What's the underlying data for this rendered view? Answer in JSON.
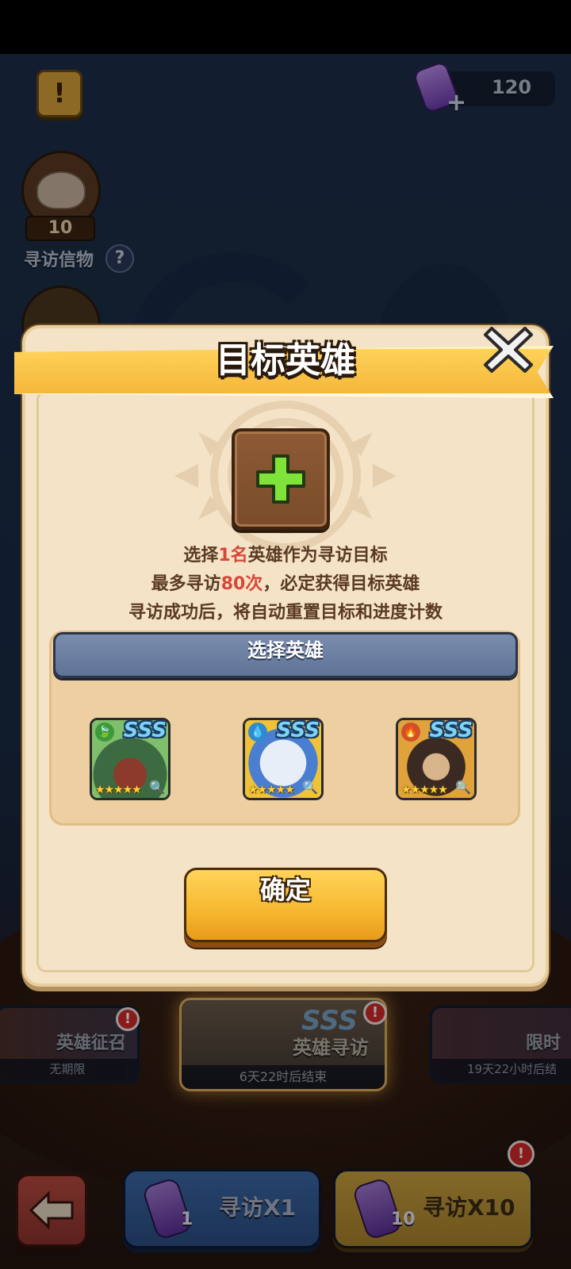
{
  "status_bar": {},
  "top": {
    "currency": {
      "value": "120",
      "icon": "scroll-icon",
      "add_icon": "plus-icon"
    },
    "info_icon": "exclamation-icon"
  },
  "sidebar": {
    "token": {
      "count": "10",
      "label": "寻访信物",
      "help": "?"
    }
  },
  "banners": [
    {
      "title": "英雄征召",
      "caption": "无期限",
      "alert": "!"
    },
    {
      "title": "英雄寻访",
      "caption": "6天22时后结束",
      "badge": "SSS",
      "alert": "!"
    },
    {
      "title": "限时",
      "caption": "19天22小时后结",
      "alert": ""
    }
  ],
  "bottom": {
    "visit1": {
      "label": "寻访X1",
      "count": "1"
    },
    "visit10": {
      "label": "寻访X10",
      "count": "10",
      "alert": "!"
    }
  },
  "dialog": {
    "title": "目标英雄",
    "desc_line1_pre": "选择",
    "desc_line1_hl": "1名",
    "desc_line1_post": "英雄作为寻访目标",
    "desc_line2_pre": "最多寻访",
    "desc_line2_hl": "80次",
    "desc_line2_post": "，必定获得目标英雄",
    "desc_line3": "寻访成功后，将自动重置目标和进度计数",
    "select_header": "选择英雄",
    "heroes": [
      {
        "rank": "SSS",
        "element": "leaf",
        "element_glyph": "🍃",
        "stars": "★★★★★",
        "zoom": "🔍"
      },
      {
        "rank": "SSS",
        "element": "water",
        "element_glyph": "💧",
        "stars": "★★★★★",
        "zoom": "🔍"
      },
      {
        "rank": "SSS",
        "element": "fire",
        "element_glyph": "🔥",
        "stars": "★★★★★",
        "zoom": "🔍"
      }
    ],
    "confirm_label": "确定"
  },
  "colors": {
    "highlight": "#d8463a",
    "title_bar": "#f4b73a",
    "panel": "#f4e3c6"
  }
}
